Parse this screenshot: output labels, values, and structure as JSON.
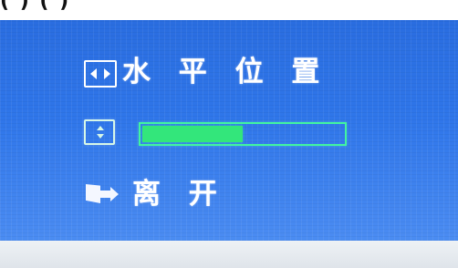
{
  "screen": {
    "top_partial_text": "(          )                     (          )"
  },
  "menu": {
    "horizontal_position_label": "水 平 位 置",
    "exit_label": "离 开"
  },
  "slider": {
    "value_fraction": 0.5
  },
  "icons": {
    "horizontal_position": "horizontal-position-icon",
    "slider": "up-down-adjust-icon",
    "exit": "exit-icon"
  },
  "colors": {
    "osd_blue": "#2f76ea",
    "slider_green": "#33e67b",
    "outline_green": "#42f4a0",
    "text_white": "#ffffff"
  }
}
